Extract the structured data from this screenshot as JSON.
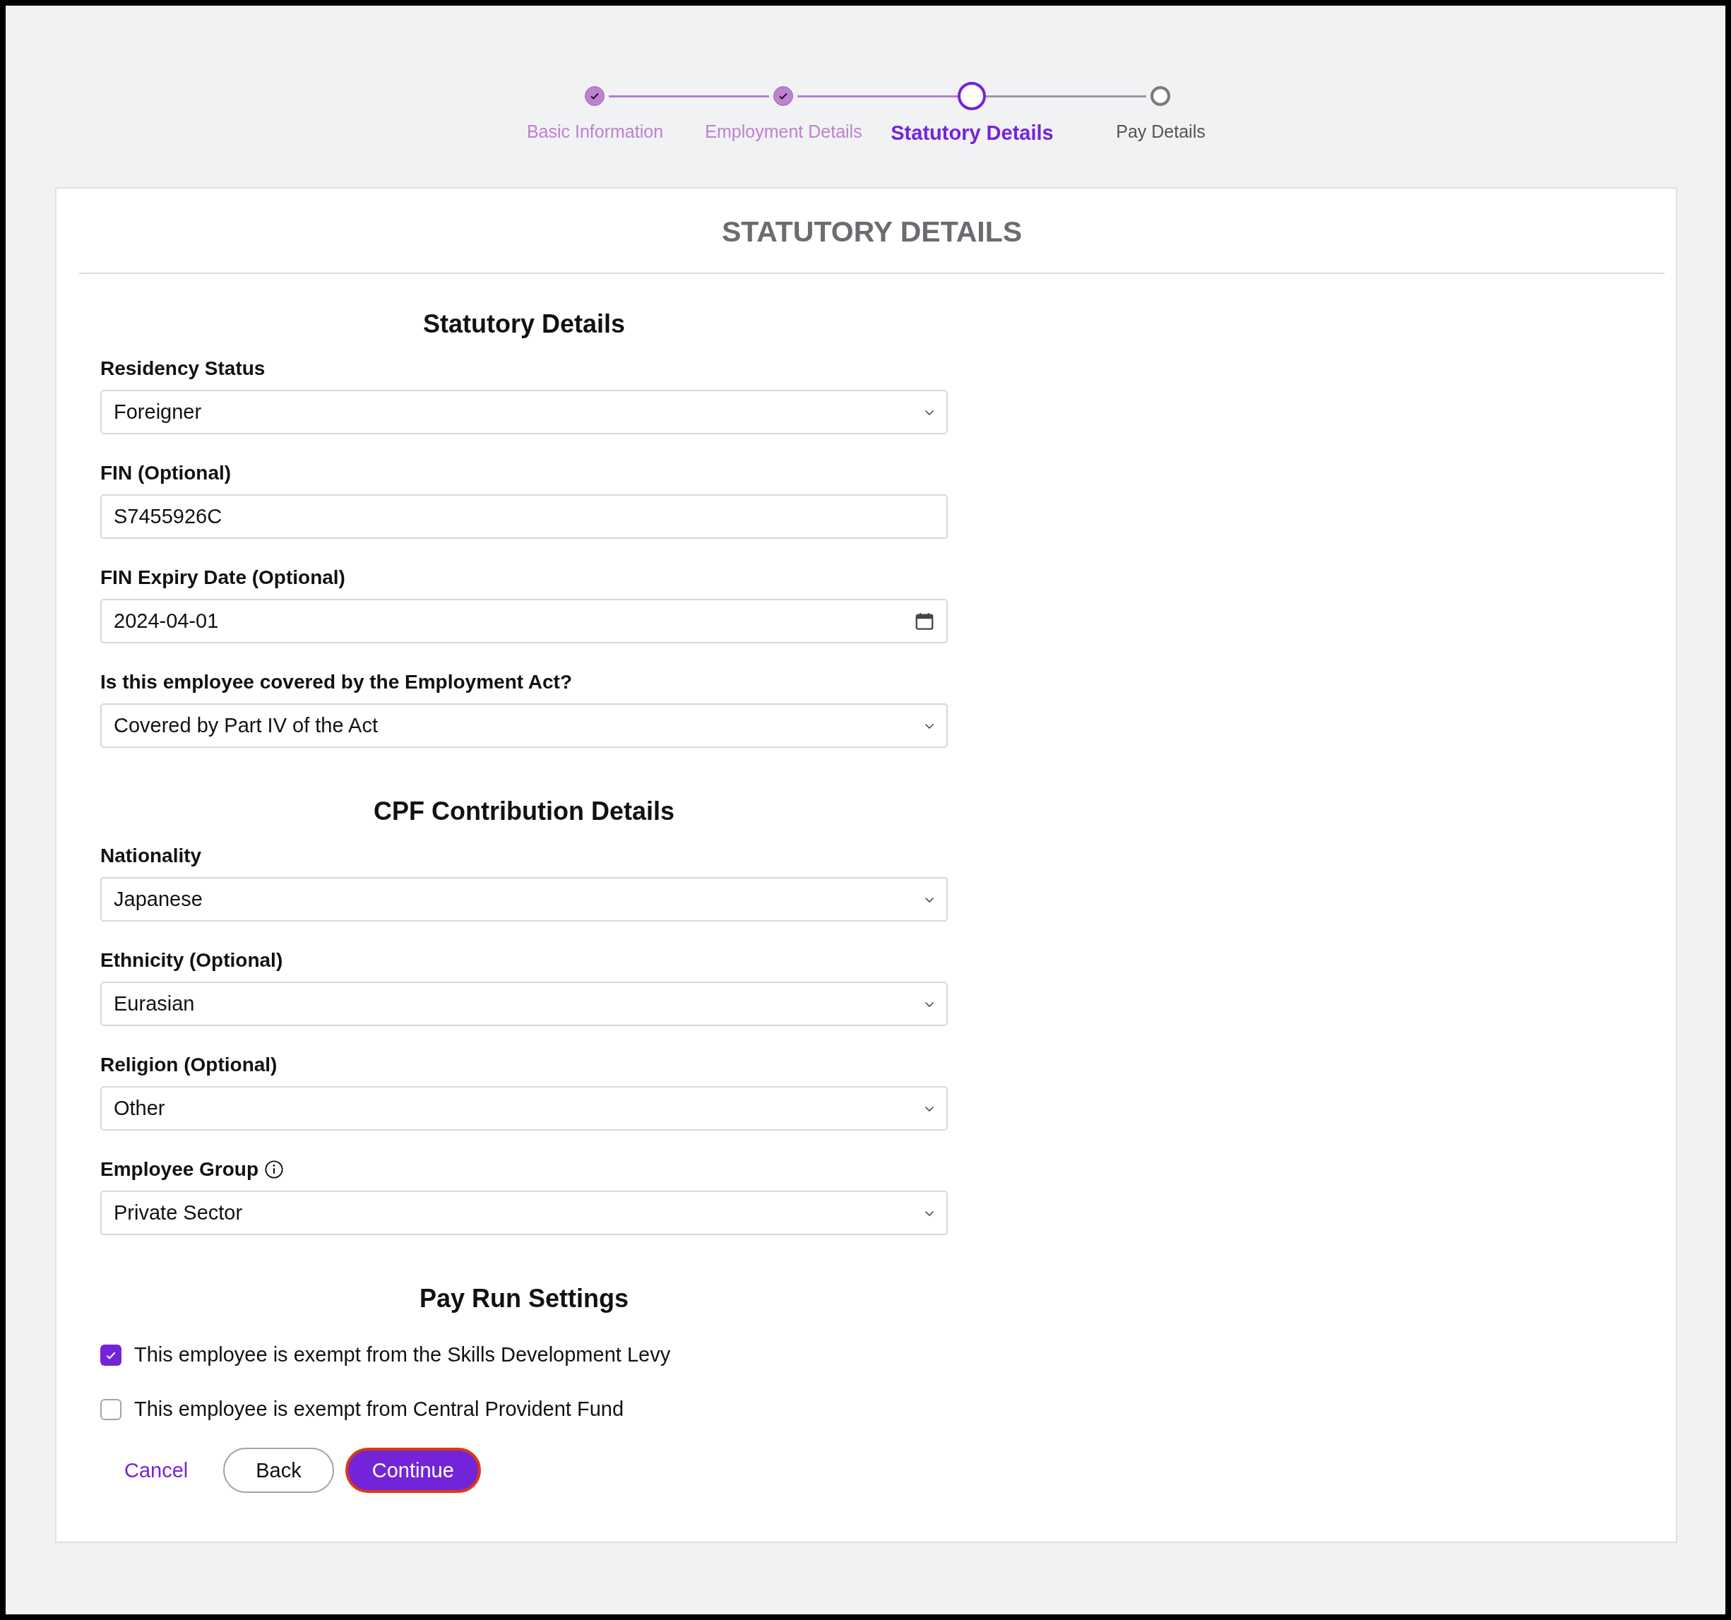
{
  "stepper": [
    {
      "label": "Basic Information",
      "completed": true,
      "selected": false
    },
    {
      "label": "Employment Details",
      "completed": true,
      "selected": false
    },
    {
      "label": "Statutory Details",
      "completed": false,
      "selected": true
    },
    {
      "label": "Pay Details",
      "completed": false,
      "selected": false
    }
  ],
  "card": {
    "title": "STATUTORY DETAILS"
  },
  "sections": [
    {
      "heading": "Statutory Details",
      "fields": [
        {
          "label": "Residency Status",
          "kind": "select",
          "value": "Foreigner",
          "info": false
        },
        {
          "label": "FIN (Optional)",
          "kind": "text",
          "value": "S7455926C",
          "info": false
        },
        {
          "label": "FIN Expiry Date (Optional)",
          "kind": "date",
          "value": "2024-04-01",
          "info": false
        },
        {
          "label": "Is this employee covered by the Employment Act?",
          "kind": "select",
          "value": "Covered by Part IV of the Act",
          "info": false
        }
      ]
    },
    {
      "heading": "CPF Contribution Details",
      "fields": [
        {
          "label": "Nationality",
          "kind": "select",
          "value": "Japanese",
          "info": false
        },
        {
          "label": "Ethnicity (Optional)",
          "kind": "select",
          "value": "Eurasian",
          "info": false
        },
        {
          "label": "Religion (Optional)",
          "kind": "select",
          "value": "Other",
          "info": false
        },
        {
          "label": "Employee Group",
          "kind": "select",
          "value": "Private Sector",
          "info": true
        }
      ]
    },
    {
      "heading": "Pay Run Settings",
      "checkboxes": [
        {
          "label": "This employee is exempt from the Skills Development Levy",
          "checked": true
        },
        {
          "label": "This employee is exempt from Central Provident Fund",
          "checked": false
        }
      ]
    }
  ],
  "buttons": [
    {
      "label": "Cancel",
      "kind": "link",
      "focused": false
    },
    {
      "label": "Back",
      "kind": "outline",
      "focused": false
    },
    {
      "label": "Continue",
      "kind": "primary",
      "focused": true
    }
  ]
}
